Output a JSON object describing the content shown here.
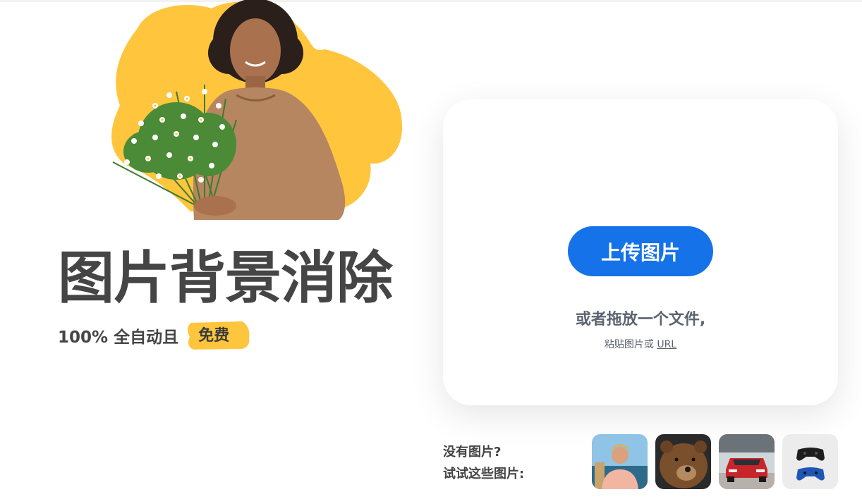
{
  "hero": {
    "title": "图片背景消除",
    "subtitle_prefix": "100% 全自动且",
    "free_badge": "免费"
  },
  "upload": {
    "button_label": "上传图片",
    "drop_text": "或者拖放一个文件,",
    "paste_prefix": "粘贴图片或",
    "url_link": "URL"
  },
  "samples": {
    "line1": "没有图片?",
    "line2": "试试这些图片:",
    "items": [
      "man-photo-icon",
      "bear-photo-icon",
      "car-photo-icon",
      "gamepad-photo-icon"
    ]
  },
  "colors": {
    "accent": "#1572e8",
    "badge_yellow": "#ffc53d",
    "title_text": "#454545"
  }
}
